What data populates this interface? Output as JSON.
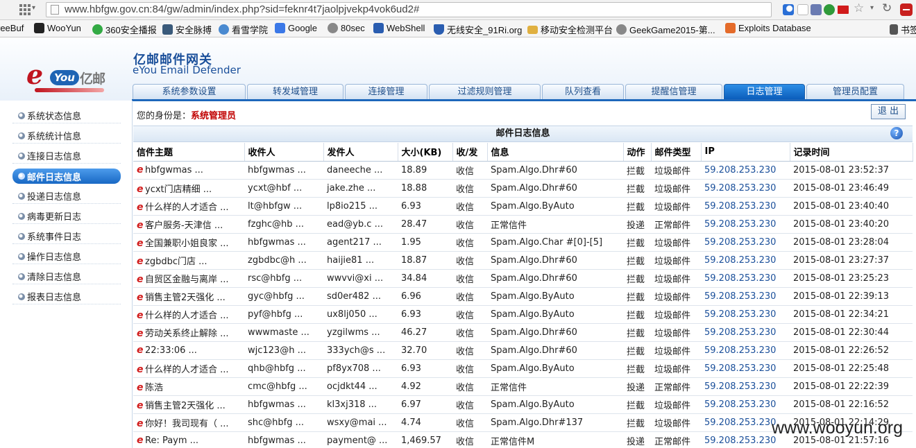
{
  "browser": {
    "url": "www.hbfgw.gov.cn:84/gw/admin/index.php?sid=feknr4t7jaolpjvekp4vok6ud2#",
    "bookmarks": [
      {
        "label": "reeBuf",
        "color": "#ffffff"
      },
      {
        "label": "WooYun",
        "color": "#222222"
      },
      {
        "label": "360安全播报",
        "color": "#33aa44"
      },
      {
        "label": "安全脉搏",
        "color": "#3a5a7a"
      },
      {
        "label": "看雪学院",
        "color": "#4a8ad0"
      },
      {
        "label": "Google",
        "color": "#3b78e7"
      },
      {
        "label": "80sec",
        "color": "#888888"
      },
      {
        "label": "WebShell",
        "color": "#2a5db0"
      },
      {
        "label": "无线安全_91Ri.org",
        "color": "#2a5db0"
      },
      {
        "label": "移动安全检测平台",
        "color": "#e0b040"
      },
      {
        "label": "GeekGame2015-第...",
        "color": "#888888"
      },
      {
        "label": "Exploits Database",
        "color": "#e46b2a"
      },
      {
        "label": "书签",
        "color": "#555555"
      }
    ]
  },
  "header": {
    "logo_e": "e",
    "logo_you": "You",
    "logo_yi": "亿邮",
    "brand_cn": "亿邮邮件网关",
    "brand_en": "eYou Email Defender",
    "tabs": [
      {
        "label": "系统参数设置"
      },
      {
        "label": "转发域管理"
      },
      {
        "label": "连接管理"
      },
      {
        "label": "过滤规则管理"
      },
      {
        "label": "队列查看"
      },
      {
        "label": "提醒信管理"
      },
      {
        "label": "日志管理",
        "active": true
      },
      {
        "label": "管理员配置"
      }
    ]
  },
  "sidebar": {
    "items": [
      {
        "label": "系统状态信息"
      },
      {
        "label": "系统统计信息"
      },
      {
        "label": "连接日志信息"
      },
      {
        "label": "邮件日志信息",
        "active": true
      },
      {
        "label": "投递日志信息"
      },
      {
        "label": "病毒更新日志"
      },
      {
        "label": "系统事件日志"
      },
      {
        "label": "操作日志信息"
      },
      {
        "label": "清除日志信息"
      },
      {
        "label": "报表日志信息"
      }
    ]
  },
  "main": {
    "identity_label": "您的身份是：",
    "identity_role": "系统管理员",
    "logout_label": "退 出",
    "section_title": "邮件日志信息",
    "help_label": "?",
    "columns": [
      "信件主题",
      "收件人",
      "发件人",
      "大小(KB)",
      "收/发",
      "信息",
      "动作",
      "邮件类型",
      "IP",
      "记录时间"
    ],
    "rows": [
      [
        "hbfgwmas ...",
        "hbfgwmas ...",
        "daneeche ...",
        "18.89",
        "收信",
        "Spam.Algo.Dhr#60",
        "拦截",
        "垃圾邮件",
        "59.208.253.230",
        "2015-08-01 23:52:37"
      ],
      [
        "ycxt门店精细 ...",
        "ycxt@hbf ...",
        "jake.zhe ...",
        "18.88",
        "收信",
        "Spam.Algo.Dhr#60",
        "拦截",
        "垃圾邮件",
        "59.208.253.230",
        "2015-08-01 23:46:49"
      ],
      [
        "什么样的人才适合 ...",
        "lt@hbfgw ...",
        "lp8io215 ...",
        "6.93",
        "收信",
        "Spam.Algo.ByAuto",
        "拦截",
        "垃圾邮件",
        "59.208.253.230",
        "2015-08-01 23:40:40"
      ],
      [
        "客户服务-天津信 ...",
        "fzghc@hb ...",
        "ead@yb.c ...",
        "28.47",
        "收信",
        "正常信件",
        "投递",
        "正常邮件",
        "59.208.253.230",
        "2015-08-01 23:40:20"
      ],
      [
        "全国兼职小姐良家 ...",
        "hbfgwmas ...",
        "agent217 ...",
        "1.95",
        "收信",
        "Spam.Algo.Char #[0]-[5]",
        "拦截",
        "垃圾邮件",
        "59.208.253.230",
        "2015-08-01 23:28:04"
      ],
      [
        "zgbdbc门店 ...",
        "zgbdbc@h ...",
        "haijie81 ...",
        "18.87",
        "收信",
        "Spam.Algo.Dhr#60",
        "拦截",
        "垃圾邮件",
        "59.208.253.230",
        "2015-08-01 23:27:37"
      ],
      [
        "自贸区金融与离岸 ...",
        "rsc@hbfg ...",
        "wwvvi@xi ...",
        "34.84",
        "收信",
        "Spam.Algo.Dhr#60",
        "拦截",
        "垃圾邮件",
        "59.208.253.230",
        "2015-08-01 23:25:23"
      ],
      [
        "销售主管2天强化 ...",
        "gyc@hbfg ...",
        "sd0er482 ...",
        "6.96",
        "收信",
        "Spam.Algo.ByAuto",
        "拦截",
        "垃圾邮件",
        "59.208.253.230",
        "2015-08-01 22:39:13"
      ],
      [
        "什么样的人才适合 ...",
        "pyf@hbfg ...",
        "ux8lj050 ...",
        "6.93",
        "收信",
        "Spam.Algo.ByAuto",
        "拦截",
        "垃圾邮件",
        "59.208.253.230",
        "2015-08-01 22:34:21"
      ],
      [
        "劳动关系终止解除 ...",
        "wwwmaste ...",
        "yzgilwms ...",
        "46.27",
        "收信",
        "Spam.Algo.Dhr#60",
        "拦截",
        "垃圾邮件",
        "59.208.253.230",
        "2015-08-01 22:30:44"
      ],
      [
        "22:33:06 ...",
        "wjc123@h ...",
        "333ych@s ...",
        "32.70",
        "收信",
        "Spam.Algo.Dhr#60",
        "拦截",
        "垃圾邮件",
        "59.208.253.230",
        "2015-08-01 22:26:52"
      ],
      [
        "什么样的人才适合 ...",
        "qhb@hbfg ...",
        "pf8yx708 ...",
        "6.93",
        "收信",
        "Spam.Algo.ByAuto",
        "拦截",
        "垃圾邮件",
        "59.208.253.230",
        "2015-08-01 22:25:48"
      ],
      [
        "陈浩",
        "cmc@hbfg ...",
        "ocjdkt44 ...",
        "4.92",
        "收信",
        "正常信件",
        "投递",
        "正常邮件",
        "59.208.253.230",
        "2015-08-01 22:22:39"
      ],
      [
        "销售主管2天强化 ...",
        "hbfgwmas ...",
        "kl3xj318 ...",
        "6.97",
        "收信",
        "Spam.Algo.ByAuto",
        "拦截",
        "垃圾邮件",
        "59.208.253.230",
        "2015-08-01 22:16:52"
      ],
      [
        "你好！我司现有（ ...",
        "shc@hbfg ...",
        "wsxy@mai ...",
        "4.74",
        "收信",
        "Spam.Algo.Dhr#137",
        "拦截",
        "垃圾邮件",
        "59.208.253.230",
        "2015-08-01 22:14:29"
      ],
      [
        "Re: Paym ...",
        "hbfgwmas ...",
        "payment@ ...",
        "1,469.57",
        "收信",
        "正常信件M",
        "投递",
        "正常邮件",
        "59.208.253.230",
        "2015-08-01 21:57:16"
      ]
    ]
  },
  "watermark": "www.wooyun.org"
}
